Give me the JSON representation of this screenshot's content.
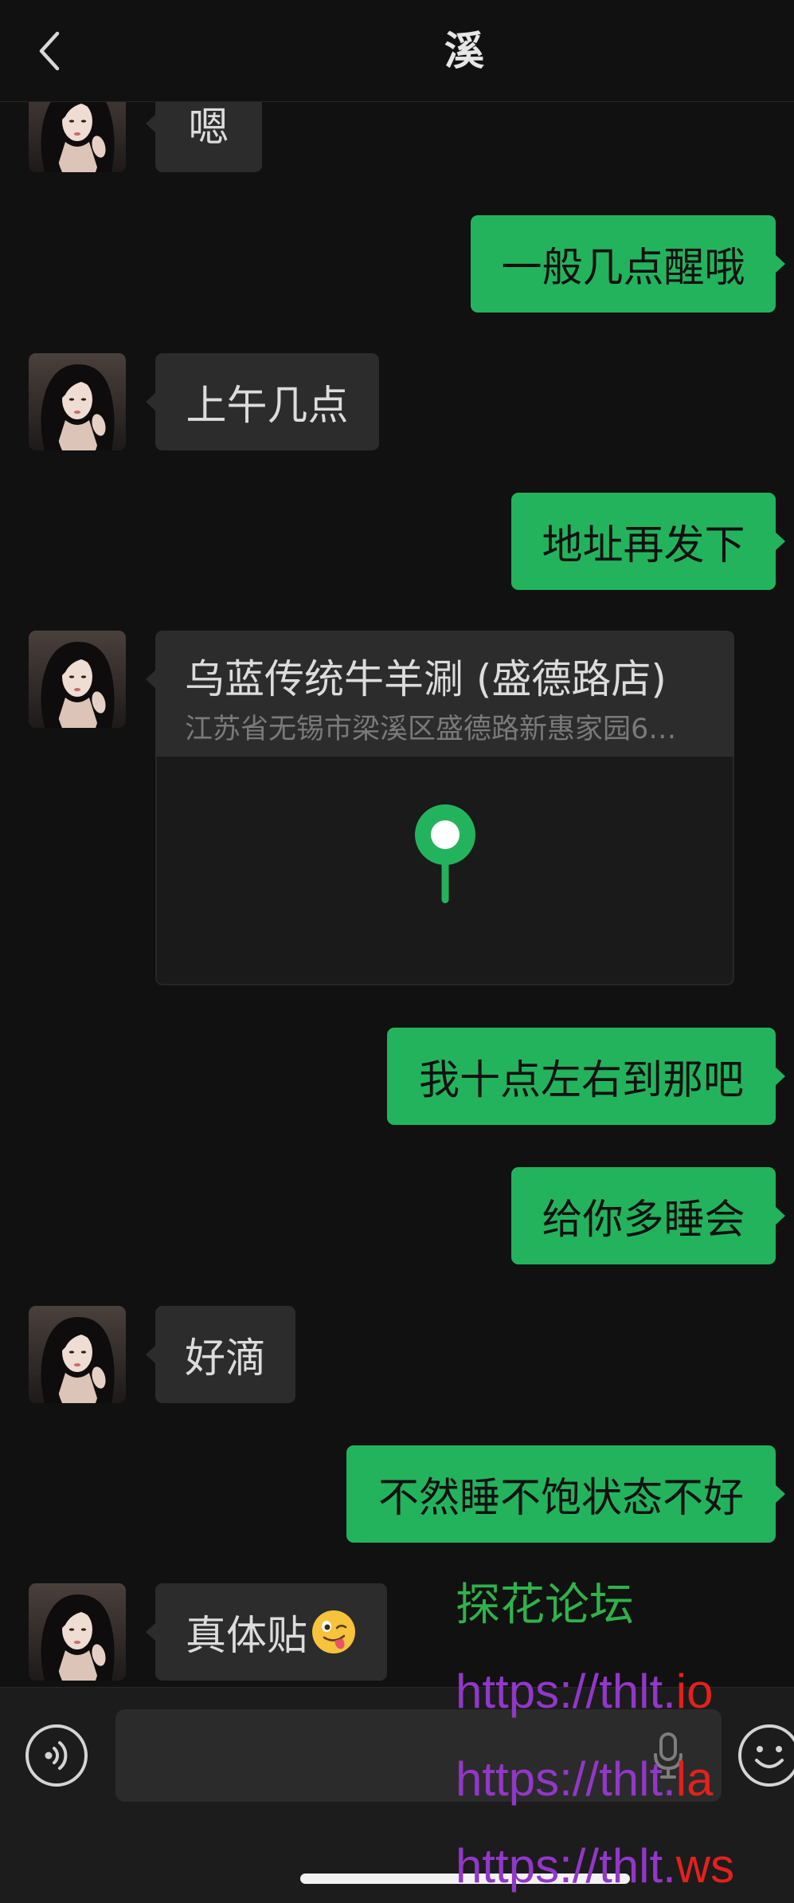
{
  "header": {
    "back_icon": "chevron-left-icon",
    "title": "溪"
  },
  "messages": [
    {
      "sent": false,
      "text": "嗯"
    },
    {
      "sent": true,
      "text": "一般几点醒哦"
    },
    {
      "sent": false,
      "text": "上午几点"
    },
    {
      "sent": true,
      "text": "地址再发下"
    },
    {
      "sent": false,
      "location": {
        "name": "乌蓝传统牛羊涮 (盛德路店)",
        "address": "江苏省无锡市梁溪区盛德路新惠家园6…",
        "pin_icon": "map-pin-icon"
      }
    },
    {
      "sent": true,
      "text": "我十点左右到那吧"
    },
    {
      "sent": true,
      "text": "给你多睡会"
    },
    {
      "sent": false,
      "text": "好滴"
    },
    {
      "sent": true,
      "text": "不然睡不饱状态不好"
    },
    {
      "sent": false,
      "text": "真体贴",
      "emoji_icon": "winking-face-with-tongue-icon"
    }
  ],
  "input_bar": {
    "voice_icon": "voice-input-icon",
    "input_value": "",
    "mic_icon": "microphone-icon",
    "emoji_icon": "smiley-face-icon"
  },
  "watermark": {
    "site_name": "探花论坛",
    "urls": [
      {
        "prefix": "https://thlt.",
        "tld": "io"
      },
      {
        "prefix": "https://thlt.",
        "tld": "la"
      },
      {
        "prefix": "https://thlt.",
        "tld": "ws"
      }
    ]
  },
  "colors": {
    "background": "#111111",
    "sent_bubble": "#24b35d",
    "received_bubble": "#2c2c2c",
    "watermark_green": "#2fb24a",
    "watermark_purple": "#9237c9",
    "watermark_red": "#e3211c"
  }
}
